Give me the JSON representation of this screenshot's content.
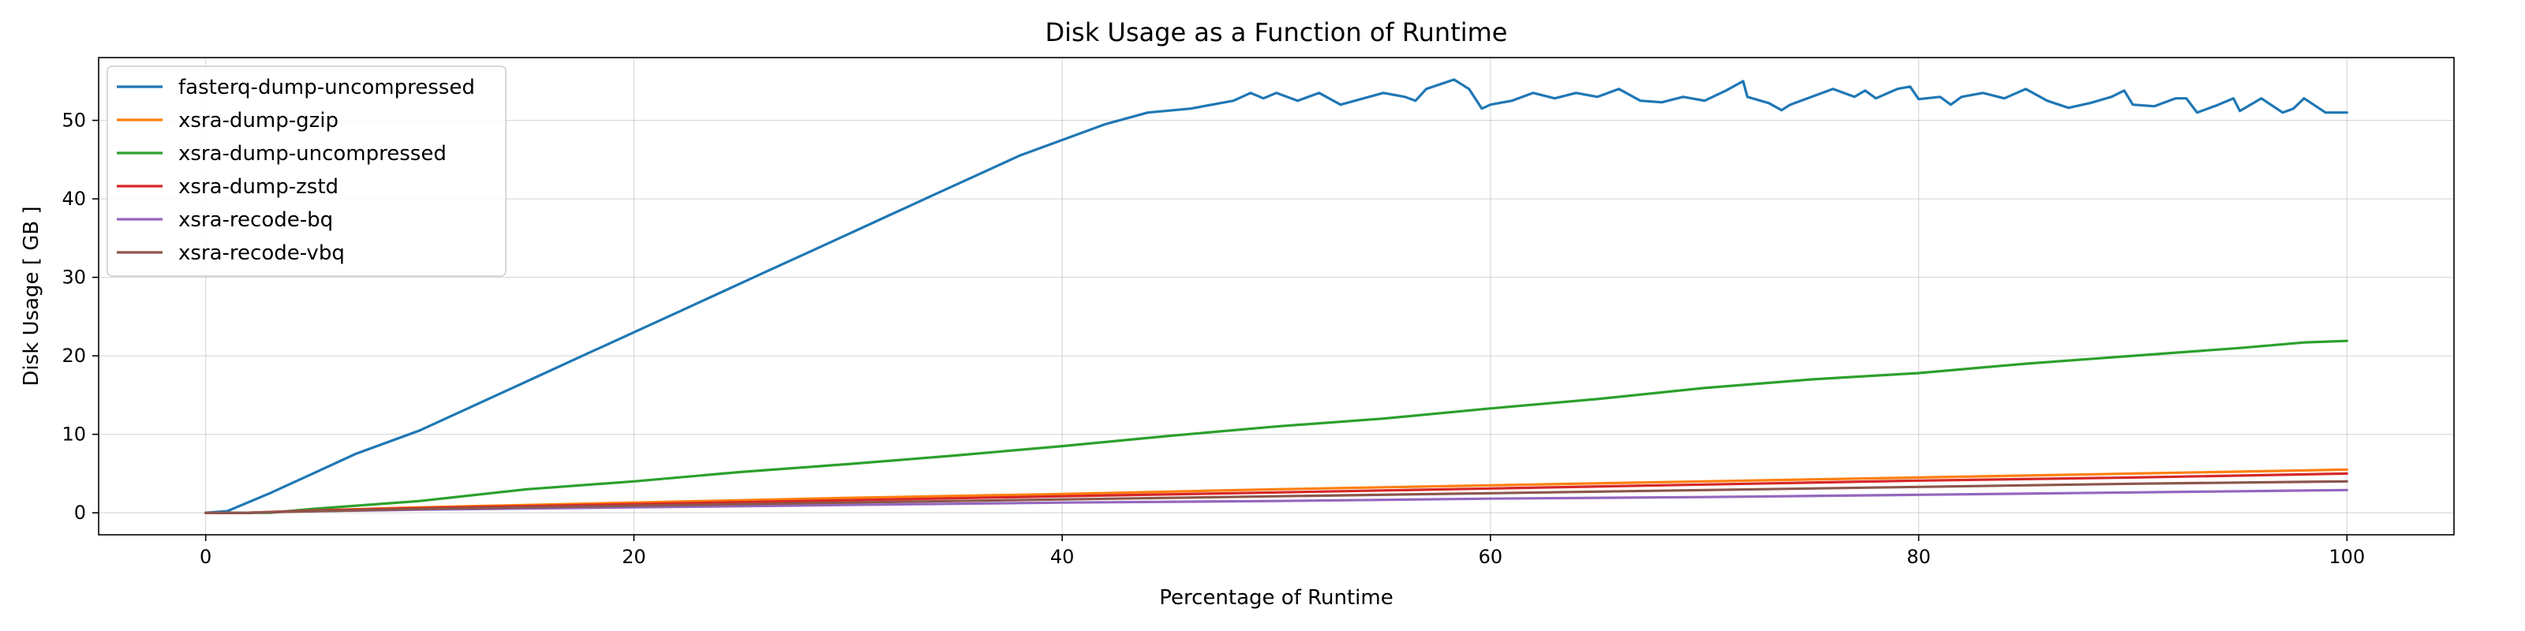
{
  "chart_data": {
    "type": "line",
    "title": "Disk Usage as a Function of Runtime",
    "xlabel": "Percentage of Runtime",
    "ylabel": "Disk Usage [ GB ]",
    "xlim": [
      -5,
      105
    ],
    "ylim": [
      -2.8,
      58
    ],
    "xticks": [
      0,
      20,
      40,
      60,
      80,
      100
    ],
    "yticks": [
      0,
      10,
      20,
      30,
      40,
      50
    ],
    "grid": true,
    "legend_position": "top-left",
    "series": [
      {
        "name": "fasterq-dump-uncompressed",
        "color": "#1f77b4",
        "x": [
          0,
          1,
          3,
          5,
          7,
          10,
          12,
          14,
          16,
          18,
          20,
          22,
          24,
          26,
          28,
          30,
          32,
          34,
          36,
          38,
          40,
          42,
          44,
          46,
          48,
          48.8,
          49.4,
          50,
          51,
          52,
          53,
          55,
          56,
          56.5,
          57,
          58.3,
          59,
          59.6,
          60,
          61,
          62,
          63,
          64,
          65,
          66,
          67,
          68,
          69,
          70,
          71,
          71.8,
          72,
          73,
          73.6,
          74,
          75,
          76,
          77,
          77.5,
          78,
          79,
          79.6,
          80,
          81,
          81.5,
          82,
          83,
          84,
          85,
          86,
          87,
          88,
          89,
          89.6,
          90,
          91,
          92,
          92.5,
          93,
          94,
          94.7,
          95,
          96,
          97,
          97.5,
          98,
          99,
          99.3,
          100
        ],
        "y": [
          0,
          0.2,
          2.5,
          5,
          7.5,
          10.5,
          13,
          15.5,
          18,
          20.5,
          23,
          25.5,
          28,
          30.5,
          33,
          35.5,
          38,
          40.5,
          43,
          45.5,
          47.5,
          49.5,
          51,
          51.5,
          52.5,
          53.5,
          52.8,
          53.5,
          52.5,
          53.5,
          52,
          53.5,
          53,
          52.5,
          54,
          55.2,
          54,
          51.5,
          52,
          52.5,
          53.5,
          52.8,
          53.5,
          53,
          54,
          52.5,
          52.3,
          53,
          52.5,
          53.8,
          55,
          53,
          52.2,
          51.3,
          52,
          53,
          54,
          53,
          53.8,
          52.8,
          54,
          54.3,
          52.7,
          53,
          52,
          53,
          53.5,
          52.8,
          54,
          52.5,
          51.6,
          52.2,
          53,
          53.8,
          52,
          51.8,
          52.8,
          52.8,
          51,
          52,
          52.8,
          51.2,
          52.8,
          51,
          51.5,
          52.8,
          51,
          51,
          51
        ]
      },
      {
        "name": "xsra-dump-gzip",
        "color": "#ff7f0e",
        "x": [
          0,
          2,
          5,
          10,
          20,
          30,
          40,
          50,
          60,
          70,
          80,
          90,
          100
        ],
        "y": [
          0,
          0,
          0.3,
          0.7,
          1.3,
          1.9,
          2.4,
          3.0,
          3.5,
          4.0,
          4.5,
          5.0,
          5.5
        ]
      },
      {
        "name": "xsra-dump-uncompressed",
        "color": "#2ca02c",
        "x": [
          0,
          3,
          5,
          10,
          15,
          20,
          25,
          30,
          35,
          40,
          45,
          50,
          55,
          60,
          65,
          70,
          75,
          80,
          85,
          90,
          95,
          98,
          100
        ],
        "y": [
          0,
          0,
          0.5,
          1.5,
          3.0,
          4.0,
          5.2,
          6.2,
          7.3,
          8.5,
          9.8,
          11,
          12,
          13.3,
          14.5,
          15.9,
          17.0,
          17.8,
          19.0,
          20.0,
          21.0,
          21.7,
          21.9
        ]
      },
      {
        "name": "xsra-dump-zstd",
        "color": "#d62728",
        "x": [
          0,
          2,
          5,
          10,
          20,
          30,
          40,
          50,
          60,
          70,
          80,
          90,
          100
        ],
        "y": [
          0,
          0,
          0.3,
          0.6,
          1.1,
          1.6,
          2.1,
          2.6,
          3.1,
          3.6,
          4.1,
          4.5,
          5.0
        ]
      },
      {
        "name": "xsra-recode-bq",
        "color": "#9467bd",
        "x": [
          0,
          2,
          5,
          10,
          20,
          30,
          40,
          50,
          60,
          70,
          80,
          90,
          100
        ],
        "y": [
          0,
          0,
          0.2,
          0.4,
          0.7,
          1.0,
          1.3,
          1.5,
          1.8,
          2.0,
          2.3,
          2.6,
          2.9
        ]
      },
      {
        "name": "xsra-recode-vbq",
        "color": "#8c564b",
        "x": [
          0,
          2,
          5,
          10,
          20,
          30,
          40,
          50,
          60,
          70,
          80,
          90,
          100
        ],
        "y": [
          0,
          0,
          0.2,
          0.5,
          0.9,
          1.3,
          1.7,
          2.1,
          2.5,
          2.9,
          3.3,
          3.7,
          4.0
        ]
      }
    ]
  }
}
